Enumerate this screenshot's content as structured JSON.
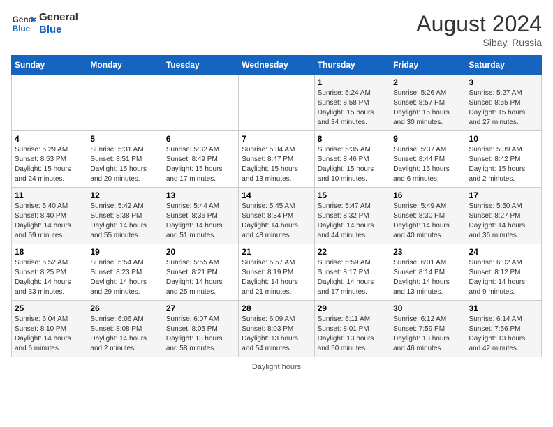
{
  "header": {
    "logo_line1": "General",
    "logo_line2": "Blue",
    "month_year": "August 2024",
    "location": "Sibay, Russia"
  },
  "footer": {
    "daylight_label": "Daylight hours"
  },
  "weekdays": [
    "Sunday",
    "Monday",
    "Tuesday",
    "Wednesday",
    "Thursday",
    "Friday",
    "Saturday"
  ],
  "weeks": [
    [
      {
        "day": "",
        "info": ""
      },
      {
        "day": "",
        "info": ""
      },
      {
        "day": "",
        "info": ""
      },
      {
        "day": "",
        "info": ""
      },
      {
        "day": "1",
        "info": "Sunrise: 5:24 AM\nSunset: 8:58 PM\nDaylight: 15 hours\nand 34 minutes."
      },
      {
        "day": "2",
        "info": "Sunrise: 5:26 AM\nSunset: 8:57 PM\nDaylight: 15 hours\nand 30 minutes."
      },
      {
        "day": "3",
        "info": "Sunrise: 5:27 AM\nSunset: 8:55 PM\nDaylight: 15 hours\nand 27 minutes."
      }
    ],
    [
      {
        "day": "4",
        "info": "Sunrise: 5:29 AM\nSunset: 8:53 PM\nDaylight: 15 hours\nand 24 minutes."
      },
      {
        "day": "5",
        "info": "Sunrise: 5:31 AM\nSunset: 8:51 PM\nDaylight: 15 hours\nand 20 minutes."
      },
      {
        "day": "6",
        "info": "Sunrise: 5:32 AM\nSunset: 8:49 PM\nDaylight: 15 hours\nand 17 minutes."
      },
      {
        "day": "7",
        "info": "Sunrise: 5:34 AM\nSunset: 8:47 PM\nDaylight: 15 hours\nand 13 minutes."
      },
      {
        "day": "8",
        "info": "Sunrise: 5:35 AM\nSunset: 8:46 PM\nDaylight: 15 hours\nand 10 minutes."
      },
      {
        "day": "9",
        "info": "Sunrise: 5:37 AM\nSunset: 8:44 PM\nDaylight: 15 hours\nand 6 minutes."
      },
      {
        "day": "10",
        "info": "Sunrise: 5:39 AM\nSunset: 8:42 PM\nDaylight: 15 hours\nand 2 minutes."
      }
    ],
    [
      {
        "day": "11",
        "info": "Sunrise: 5:40 AM\nSunset: 8:40 PM\nDaylight: 14 hours\nand 59 minutes."
      },
      {
        "day": "12",
        "info": "Sunrise: 5:42 AM\nSunset: 8:38 PM\nDaylight: 14 hours\nand 55 minutes."
      },
      {
        "day": "13",
        "info": "Sunrise: 5:44 AM\nSunset: 8:36 PM\nDaylight: 14 hours\nand 51 minutes."
      },
      {
        "day": "14",
        "info": "Sunrise: 5:45 AM\nSunset: 8:34 PM\nDaylight: 14 hours\nand 48 minutes."
      },
      {
        "day": "15",
        "info": "Sunrise: 5:47 AM\nSunset: 8:32 PM\nDaylight: 14 hours\nand 44 minutes."
      },
      {
        "day": "16",
        "info": "Sunrise: 5:49 AM\nSunset: 8:30 PM\nDaylight: 14 hours\nand 40 minutes."
      },
      {
        "day": "17",
        "info": "Sunrise: 5:50 AM\nSunset: 8:27 PM\nDaylight: 14 hours\nand 36 minutes."
      }
    ],
    [
      {
        "day": "18",
        "info": "Sunrise: 5:52 AM\nSunset: 8:25 PM\nDaylight: 14 hours\nand 33 minutes."
      },
      {
        "day": "19",
        "info": "Sunrise: 5:54 AM\nSunset: 8:23 PM\nDaylight: 14 hours\nand 29 minutes."
      },
      {
        "day": "20",
        "info": "Sunrise: 5:55 AM\nSunset: 8:21 PM\nDaylight: 14 hours\nand 25 minutes."
      },
      {
        "day": "21",
        "info": "Sunrise: 5:57 AM\nSunset: 8:19 PM\nDaylight: 14 hours\nand 21 minutes."
      },
      {
        "day": "22",
        "info": "Sunrise: 5:59 AM\nSunset: 8:17 PM\nDaylight: 14 hours\nand 17 minutes."
      },
      {
        "day": "23",
        "info": "Sunrise: 6:01 AM\nSunset: 8:14 PM\nDaylight: 14 hours\nand 13 minutes."
      },
      {
        "day": "24",
        "info": "Sunrise: 6:02 AM\nSunset: 8:12 PM\nDaylight: 14 hours\nand 9 minutes."
      }
    ],
    [
      {
        "day": "25",
        "info": "Sunrise: 6:04 AM\nSunset: 8:10 PM\nDaylight: 14 hours\nand 6 minutes."
      },
      {
        "day": "26",
        "info": "Sunrise: 6:06 AM\nSunset: 8:08 PM\nDaylight: 14 hours\nand 2 minutes."
      },
      {
        "day": "27",
        "info": "Sunrise: 6:07 AM\nSunset: 8:05 PM\nDaylight: 13 hours\nand 58 minutes."
      },
      {
        "day": "28",
        "info": "Sunrise: 6:09 AM\nSunset: 8:03 PM\nDaylight: 13 hours\nand 54 minutes."
      },
      {
        "day": "29",
        "info": "Sunrise: 6:11 AM\nSunset: 8:01 PM\nDaylight: 13 hours\nand 50 minutes."
      },
      {
        "day": "30",
        "info": "Sunrise: 6:12 AM\nSunset: 7:59 PM\nDaylight: 13 hours\nand 46 minutes."
      },
      {
        "day": "31",
        "info": "Sunrise: 6:14 AM\nSunset: 7:56 PM\nDaylight: 13 hours\nand 42 minutes."
      }
    ]
  ]
}
